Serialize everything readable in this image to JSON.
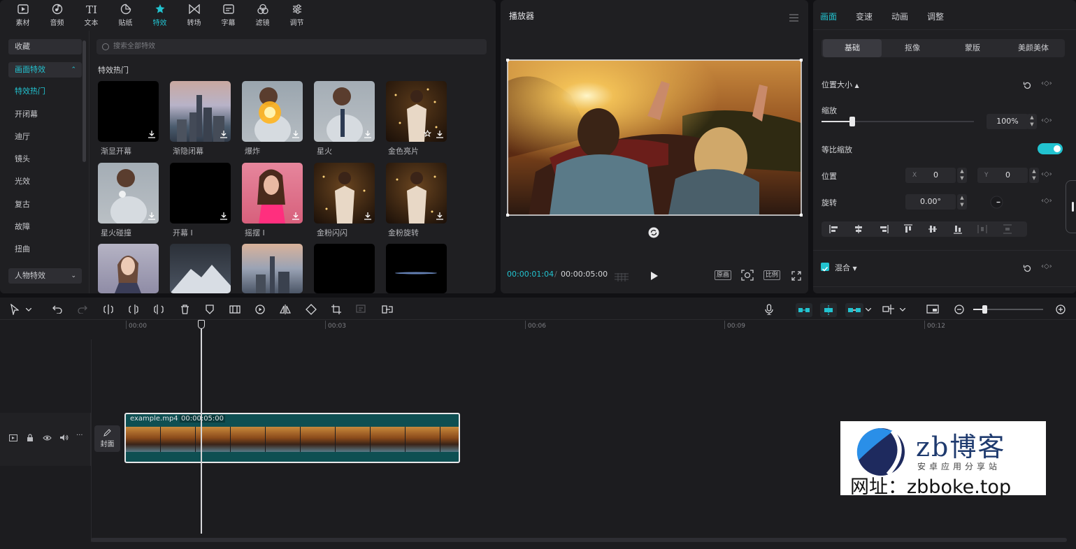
{
  "toolbar": {
    "tools": [
      {
        "label": "素材",
        "icon": "media-icon"
      },
      {
        "label": "音频",
        "icon": "audio-icon"
      },
      {
        "label": "文本",
        "icon": "text-icon"
      },
      {
        "label": "贴纸",
        "icon": "sticker-icon"
      },
      {
        "label": "特效",
        "icon": "effects-icon"
      },
      {
        "label": "转场",
        "icon": "transition-icon"
      },
      {
        "label": "字幕",
        "icon": "caption-icon"
      },
      {
        "label": "滤镜",
        "icon": "filter-icon"
      },
      {
        "label": "调节",
        "icon": "adjust-icon"
      }
    ],
    "active": "特效",
    "accent": "#22c3d0"
  },
  "categories": {
    "favorites": "收藏",
    "screen_effects": "画面特效",
    "items": [
      "特效热门",
      "开闭幕",
      "迪厅",
      "镜头",
      "光效",
      "复古",
      "故障",
      "扭曲"
    ],
    "selected": "特效热门",
    "person_effects": "人物特效"
  },
  "search": {
    "placeholder": "搜索全部特效"
  },
  "section_title": "特效热门",
  "effects": [
    {
      "name": "渐显开幕"
    },
    {
      "name": "渐隐闭幕"
    },
    {
      "name": "爆炸"
    },
    {
      "name": "星火"
    },
    {
      "name": "金色亮片"
    },
    {
      "name": "星火碰撞"
    },
    {
      "name": "开幕 I"
    },
    {
      "name": "摇摆 I"
    },
    {
      "name": "金粉闪闪"
    },
    {
      "name": "金粉旋转"
    }
  ],
  "player": {
    "title": "播放器",
    "current_time": "00:00:01:04",
    "total_time": "00:00:05:00",
    "original_label": "原画",
    "ratio_label": "比例"
  },
  "props": {
    "tabs": [
      "画面",
      "变速",
      "动画",
      "调整"
    ],
    "active_tab": "画面",
    "subtabs": [
      "基础",
      "抠像",
      "蒙版",
      "美颜美体"
    ],
    "active_subtab": "基础",
    "position_size": "位置大小",
    "scale_label": "缩放",
    "scale_value": "100%",
    "scale_slider_fraction": 0.2,
    "uniform_scale": "等比缩放",
    "uniform_scale_on": true,
    "position_label": "位置",
    "x_label": "X",
    "x_value": "0",
    "y_label": "Y",
    "y_value": "0",
    "rotation_label": "旋转",
    "rotation_value": "0.00°",
    "blend_label": "混合"
  },
  "timeline": {
    "ruler": [
      "00:00",
      "00:03",
      "00:06",
      "00:09",
      "00:12"
    ],
    "cover_label": "封面",
    "clip_name": "example.mp4",
    "clip_duration": "00:00:05:00"
  },
  "watermark": {
    "brand": "zb博客",
    "tagline": "安卓应用分享站",
    "url": "网址：zbboke.top"
  }
}
